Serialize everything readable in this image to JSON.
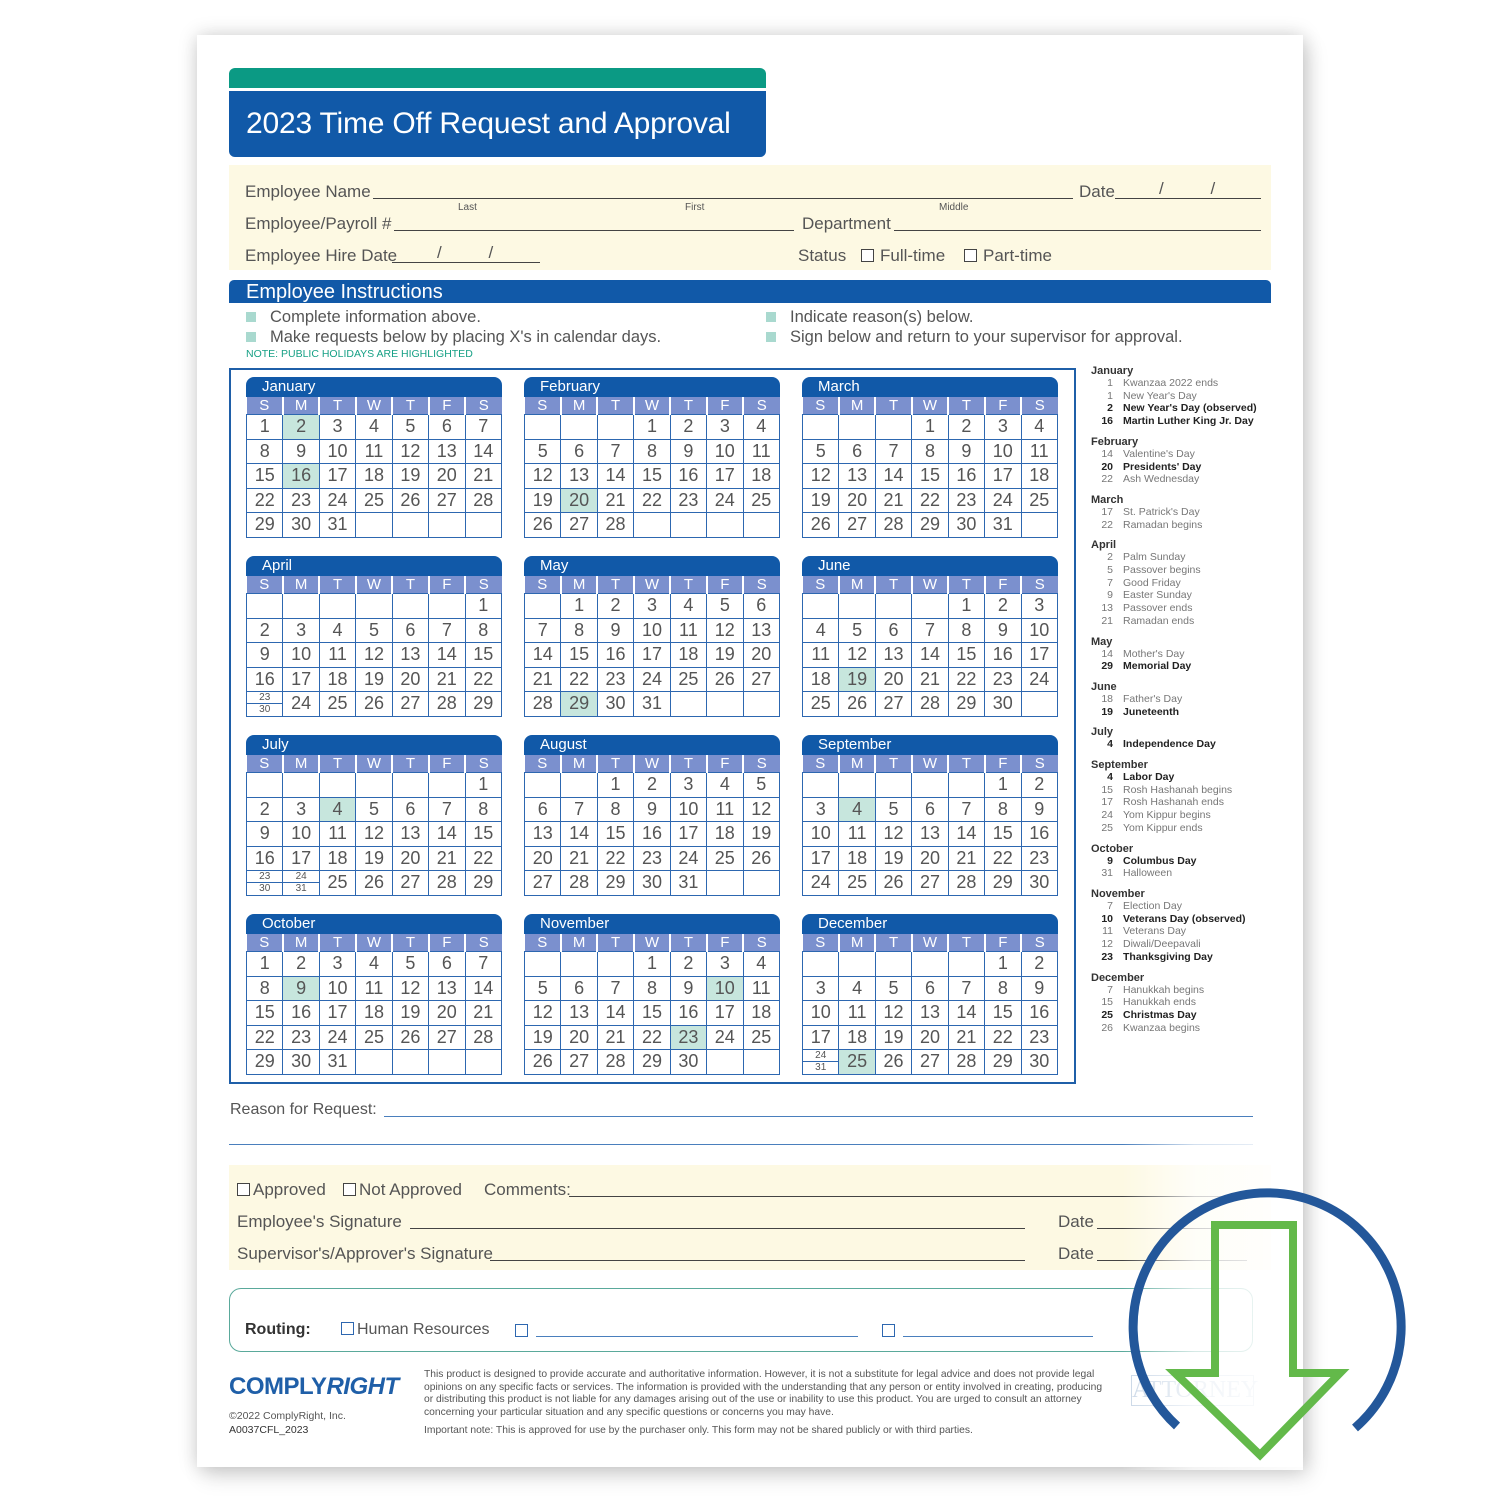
{
  "header": {
    "title": "2023 Time Off Request and Approval"
  },
  "employee_info": {
    "name_label": "Employee Name",
    "name_sublabels": [
      "Last",
      "First",
      "Middle"
    ],
    "date_label": "Date",
    "date_value": "/ /",
    "payroll_label": "Employee/Payroll #",
    "department_label": "Department",
    "hire_date_label": "Employee Hire Date",
    "hire_date_value": "/ /",
    "status_label": "Status",
    "status_options": [
      "Full-time",
      "Part-time"
    ]
  },
  "instructions": {
    "title": "Employee Instructions",
    "items": [
      "Complete information above.",
      "Make requests below by placing X's in calendar days.",
      "Indicate reason(s) below.",
      "Sign below and return to your supervisor for approval."
    ],
    "note": "NOTE: PUBLIC HOLIDAYS ARE HIGHLIGHTED"
  },
  "calendar": {
    "weekdays": [
      "S",
      "M",
      "T",
      "W",
      "T",
      "F",
      "S"
    ],
    "months": [
      {
        "name": "January",
        "start": 0,
        "days": 31,
        "holidays": [
          2,
          16
        ]
      },
      {
        "name": "February",
        "start": 3,
        "days": 28,
        "holidays": [
          20
        ]
      },
      {
        "name": "March",
        "start": 3,
        "days": 31,
        "holidays": []
      },
      {
        "name": "April",
        "start": 6,
        "days": 30,
        "holidays": []
      },
      {
        "name": "May",
        "start": 1,
        "days": 31,
        "holidays": [
          29
        ]
      },
      {
        "name": "June",
        "start": 4,
        "days": 30,
        "holidays": [
          19
        ]
      },
      {
        "name": "July",
        "start": 6,
        "days": 31,
        "holidays": [
          4
        ]
      },
      {
        "name": "August",
        "start": 2,
        "days": 31,
        "holidays": []
      },
      {
        "name": "September",
        "start": 5,
        "days": 30,
        "holidays": [
          4
        ]
      },
      {
        "name": "October",
        "start": 0,
        "days": 31,
        "holidays": [
          9
        ]
      },
      {
        "name": "November",
        "start": 3,
        "days": 30,
        "holidays": [
          10,
          23
        ]
      },
      {
        "name": "December",
        "start": 5,
        "days": 31,
        "holidays": [
          25
        ]
      }
    ]
  },
  "holiday_list": [
    {
      "month": "January",
      "items": [
        {
          "day": "1",
          "name": "Kwanzaa 2022 ends",
          "bold": false
        },
        {
          "day": "1",
          "name": "New Year's Day",
          "bold": false
        },
        {
          "day": "2",
          "name": "New Year's Day (observed)",
          "bold": true
        },
        {
          "day": "16",
          "name": "Martin Luther King Jr. Day",
          "bold": true
        }
      ]
    },
    {
      "month": "February",
      "items": [
        {
          "day": "14",
          "name": "Valentine's Day",
          "bold": false
        },
        {
          "day": "20",
          "name": "Presidents' Day",
          "bold": true
        },
        {
          "day": "22",
          "name": "Ash Wednesday",
          "bold": false
        }
      ]
    },
    {
      "month": "March",
      "items": [
        {
          "day": "17",
          "name": "St. Patrick's Day",
          "bold": false
        },
        {
          "day": "22",
          "name": "Ramadan begins",
          "bold": false
        }
      ]
    },
    {
      "month": "April",
      "items": [
        {
          "day": "2",
          "name": "Palm Sunday",
          "bold": false
        },
        {
          "day": "5",
          "name": "Passover begins",
          "bold": false
        },
        {
          "day": "7",
          "name": "Good Friday",
          "bold": false
        },
        {
          "day": "9",
          "name": "Easter Sunday",
          "bold": false
        },
        {
          "day": "13",
          "name": "Passover ends",
          "bold": false
        },
        {
          "day": "21",
          "name": "Ramadan ends",
          "bold": false
        }
      ]
    },
    {
      "month": "May",
      "items": [
        {
          "day": "14",
          "name": "Mother's Day",
          "bold": false
        },
        {
          "day": "29",
          "name": "Memorial Day",
          "bold": true
        }
      ]
    },
    {
      "month": "June",
      "items": [
        {
          "day": "18",
          "name": "Father's Day",
          "bold": false
        },
        {
          "day": "19",
          "name": "Juneteenth",
          "bold": true
        }
      ]
    },
    {
      "month": "July",
      "items": [
        {
          "day": "4",
          "name": "Independence Day",
          "bold": true
        }
      ]
    },
    {
      "month": "September",
      "items": [
        {
          "day": "4",
          "name": "Labor Day",
          "bold": true
        },
        {
          "day": "15",
          "name": "Rosh Hashanah begins",
          "bold": false
        },
        {
          "day": "17",
          "name": "Rosh Hashanah ends",
          "bold": false
        },
        {
          "day": "24",
          "name": "Yom Kippur begins",
          "bold": false
        },
        {
          "day": "25",
          "name": "Yom Kippur ends",
          "bold": false
        }
      ]
    },
    {
      "month": "October",
      "items": [
        {
          "day": "9",
          "name": "Columbus Day",
          "bold": true
        },
        {
          "day": "31",
          "name": "Halloween",
          "bold": false
        }
      ]
    },
    {
      "month": "November",
      "items": [
        {
          "day": "7",
          "name": "Election Day",
          "bold": false
        },
        {
          "day": "10",
          "name": "Veterans Day (observed)",
          "bold": true
        },
        {
          "day": "11",
          "name": "Veterans Day",
          "bold": false
        },
        {
          "day": "12",
          "name": "Diwali/Deepavali",
          "bold": false
        },
        {
          "day": "23",
          "name": "Thanksgiving Day",
          "bold": true
        }
      ]
    },
    {
      "month": "December",
      "items": [
        {
          "day": "7",
          "name": "Hanukkah begins",
          "bold": false
        },
        {
          "day": "15",
          "name": "Hanukkah ends",
          "bold": false
        },
        {
          "day": "25",
          "name": "Christmas Day",
          "bold": true
        },
        {
          "day": "26",
          "name": "Kwanzaa begins",
          "bold": false
        }
      ]
    }
  ],
  "request": {
    "reason_label": "Reason for Request:"
  },
  "approval": {
    "approved_label": "Approved",
    "not_approved_label": "Not Approved",
    "comments_label": "Comments:",
    "employee_signature_label": "Employee's Signature",
    "supervisor_signature_label": "Supervisor's/Approver's Signature",
    "date_label": "Date"
  },
  "routing": {
    "label": "Routing:",
    "options": [
      "Human Resources"
    ]
  },
  "footer": {
    "logo_part1": "COMPLY",
    "logo_part2": "RIGHT",
    "copyright": "©2022 ComplyRight, Inc.",
    "product_code": "A0037CFL_2023",
    "disclaimer": "This product is designed to provide accurate and authoritative information. However, it is not a substitute for legal advice and does not provide legal opinions on any specific facts or services. The information is provided with the understanding that any person or entity involved in creating, producing or distributing this product is not liable for any damages arising out of the use or inability to use this product. You are urged to consult an attorney concerning your particular situation and any specific questions or concerns you may have.",
    "important_note": "Important note: This is approved for use by the purchaser only. This form may not be shared publicly or with third parties.",
    "stamp_text": "ATTORNEY"
  },
  "overlay": {
    "icon": "download-icon",
    "ring_color": "#23579a",
    "arrow_color": "#63b94a"
  },
  "colors": {
    "primary_blue": "#1159a8",
    "teal": "#0b9a84",
    "weekday_header": "#7b90ce",
    "holiday_highlight": "#c7e6dd",
    "form_background": "#fdf9e3"
  }
}
